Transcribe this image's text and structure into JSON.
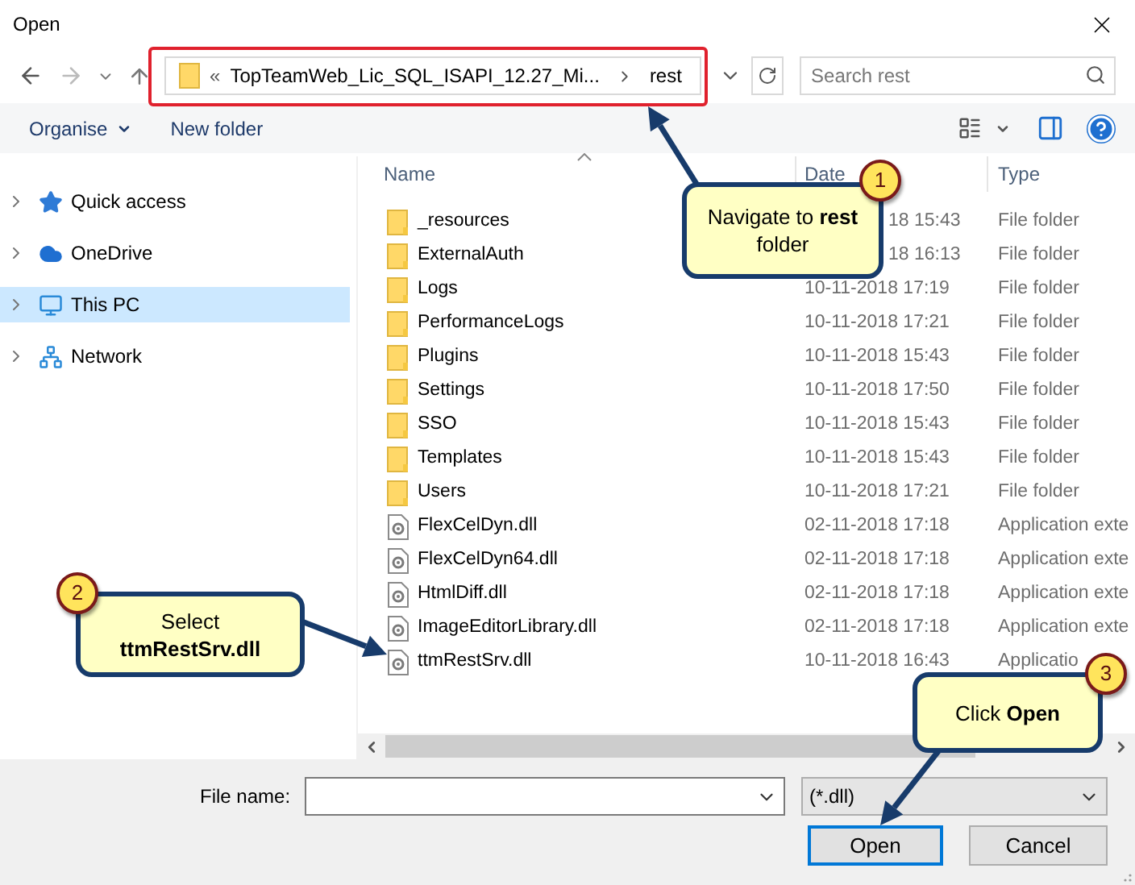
{
  "window": {
    "title": "Open"
  },
  "address_bar": {
    "overflow": "«",
    "path": "TopTeamWeb_Lic_SQL_ISAPI_12.27_Mi...",
    "current": "rest"
  },
  "search": {
    "placeholder": "Search rest"
  },
  "toolbar": {
    "organise": "Organise",
    "new_folder": "New folder"
  },
  "sidebar": {
    "items": [
      {
        "kind": "star",
        "label": "Quick access",
        "selected": false
      },
      {
        "kind": "cloud",
        "label": "OneDrive",
        "selected": false
      },
      {
        "kind": "pc",
        "label": "This PC",
        "selected": true
      },
      {
        "kind": "network",
        "label": "Network",
        "selected": false
      }
    ]
  },
  "table": {
    "columns": [
      "Name",
      "Date",
      "Type"
    ],
    "rows": [
      {
        "kind": "folder",
        "name": "_resources",
        "date": "18 15:43",
        "date_covered": true,
        "type": "File folder"
      },
      {
        "kind": "folder",
        "name": "ExternalAuth",
        "date": "18 16:13",
        "date_covered": true,
        "type": "File folder"
      },
      {
        "kind": "folder",
        "name": "Logs",
        "date": "10-11-2018 17:19",
        "date_covered": false,
        "type": "File folder"
      },
      {
        "kind": "folder",
        "name": "PerformanceLogs",
        "date": "10-11-2018 17:21",
        "date_covered": false,
        "type": "File folder"
      },
      {
        "kind": "folder",
        "name": "Plugins",
        "date": "10-11-2018 15:43",
        "date_covered": false,
        "type": "File folder"
      },
      {
        "kind": "folder",
        "name": "Settings",
        "date": "10-11-2018 17:50",
        "date_covered": false,
        "type": "File folder"
      },
      {
        "kind": "folder",
        "name": "SSO",
        "date": "10-11-2018 15:43",
        "date_covered": false,
        "type": "File folder"
      },
      {
        "kind": "folder",
        "name": "Templates",
        "date": "10-11-2018 15:43",
        "date_covered": false,
        "type": "File folder"
      },
      {
        "kind": "folder",
        "name": "Users",
        "date": "10-11-2018 17:21",
        "date_covered": false,
        "type": "File folder"
      },
      {
        "kind": "dll",
        "name": "FlexCelDyn.dll",
        "date": "02-11-2018 17:18",
        "date_covered": false,
        "type": "Application exte"
      },
      {
        "kind": "dll",
        "name": "FlexCelDyn64.dll",
        "date": "02-11-2018 17:18",
        "date_covered": false,
        "type": "Application exte"
      },
      {
        "kind": "dll",
        "name": "HtmlDiff.dll",
        "date": "02-11-2018 17:18",
        "date_covered": false,
        "type": "Application exte"
      },
      {
        "kind": "dll",
        "name": "ImageEditorLibrary.dll",
        "date": "02-11-2018 17:18",
        "date_covered": false,
        "type": "Application exte"
      },
      {
        "kind": "dll",
        "name": "ttmRestSrv.dll",
        "date": "10-11-2018 16:43",
        "date_covered": false,
        "type": "Applicatio"
      }
    ]
  },
  "file_name": {
    "label": "File name:"
  },
  "file_type": {
    "value": "(*.dll)"
  },
  "buttons": {
    "open": "Open",
    "cancel": "Cancel"
  },
  "callouts": [
    {
      "number": "1",
      "text": "Navigate to **rest** folder"
    },
    {
      "number": "2",
      "text": "Select **ttmRestSrv.dll**"
    },
    {
      "number": "3",
      "text": "Click **Open**"
    }
  ]
}
